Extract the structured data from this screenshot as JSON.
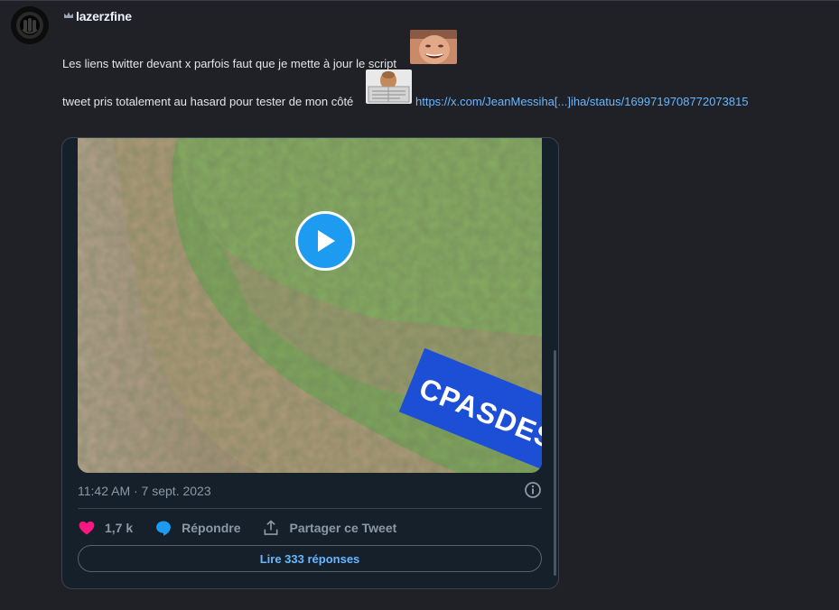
{
  "message": {
    "author": "lazerzfine",
    "line1": "Les liens twitter devant x parfois faut que je mette à jour le script",
    "line2": "tweet pris totalement au hasard pour tester de mon côté",
    "link_text": "https://x.com/JeanMessiha[...]iha/status/1699719708772073815"
  },
  "embed": {
    "video_overlay_text": "CPASDES",
    "timestamp": "11:42 AM · 7 sept. 2023",
    "likes": "1,7 k",
    "reply_label": "Répondre",
    "share_label": "Partager ce Tweet",
    "read_replies": "Lire 333 réponses"
  },
  "colors": {
    "background": "#1f2126",
    "embed_background": "#15202b",
    "link": "#6ab6ff",
    "like": "#f91880",
    "play": "#1d9bf0"
  },
  "icons": [
    "crown-icon",
    "play-icon",
    "info-icon",
    "heart-icon",
    "reply-icon",
    "share-icon"
  ]
}
